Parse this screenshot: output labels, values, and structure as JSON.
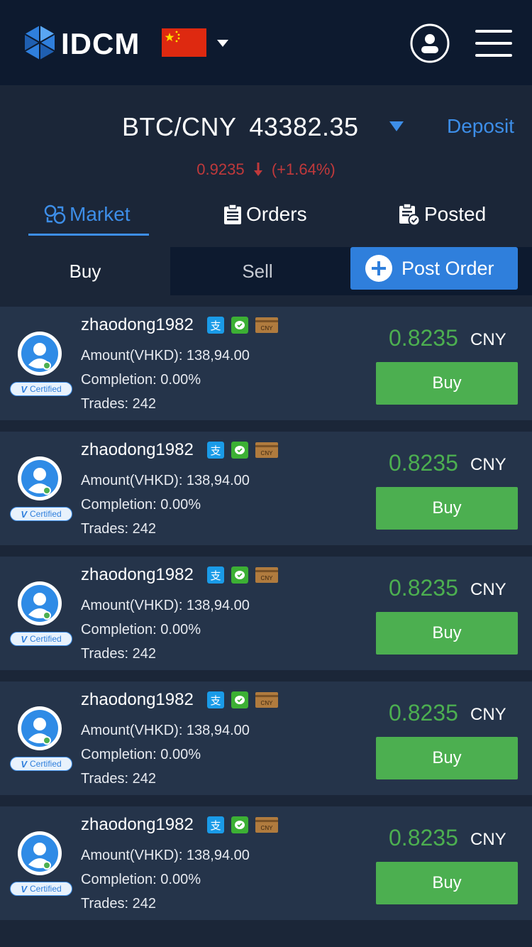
{
  "header": {
    "logo_text": "IDCM",
    "flag_icon": "china-flag-icon",
    "icons": {
      "user": "user-circle-icon",
      "menu": "hamburger-menu-icon"
    }
  },
  "ticker": {
    "pair": "BTC/CNY",
    "price": "43382.35",
    "deposit_label": "Deposit",
    "change_value": "0.9235",
    "change_percent": "(+1.64%)",
    "change_color": "#c0393b"
  },
  "tabs": [
    {
      "label": "Market",
      "icon": "market-exchange-icon",
      "active": true
    },
    {
      "label": "Orders",
      "icon": "clipboard-list-icon",
      "active": false
    },
    {
      "label": "Posted",
      "icon": "clipboard-check-icon",
      "active": false
    }
  ],
  "filter": {
    "buy_label": "Buy",
    "sell_label": "Sell",
    "post_order_label": "Post Order"
  },
  "colors": {
    "accent": "#3d8ee8",
    "buy_green": "#4caf50",
    "card_bg": "#25344a",
    "header_bg": "#0d1a2f"
  },
  "listings": [
    {
      "username": "zhaodong1982",
      "amount": "Amount(VHKD): 138,94.00",
      "completion": "Completion: 0.00%",
      "trades": "Trades: 242",
      "price": "0.8235",
      "currency": "CNY",
      "action": "Buy",
      "badge": "Certified",
      "card_label": "CNY"
    },
    {
      "username": "zhaodong1982",
      "amount": "Amount(VHKD): 138,94.00",
      "completion": "Completion: 0.00%",
      "trades": "Trades: 242",
      "price": "0.8235",
      "currency": "CNY",
      "action": "Buy",
      "badge": "Certified",
      "card_label": "CNY"
    },
    {
      "username": "zhaodong1982",
      "amount": "Amount(VHKD): 138,94.00",
      "completion": "Completion: 0.00%",
      "trades": "Trades: 242",
      "price": "0.8235",
      "currency": "CNY",
      "action": "Buy",
      "badge": "Certified",
      "card_label": "CNY"
    },
    {
      "username": "zhaodong1982",
      "amount": "Amount(VHKD): 138,94.00",
      "completion": "Completion: 0.00%",
      "trades": "Trades: 242",
      "price": "0.8235",
      "currency": "CNY",
      "action": "Buy",
      "badge": "Certified",
      "card_label": "CNY"
    },
    {
      "username": "zhaodong1982",
      "amount": "Amount(VHKD): 138,94.00",
      "completion": "Completion: 0.00%",
      "trades": "Trades: 242",
      "price": "0.8235",
      "currency": "CNY",
      "action": "Buy",
      "badge": "Certified",
      "card_label": "CNY"
    }
  ]
}
